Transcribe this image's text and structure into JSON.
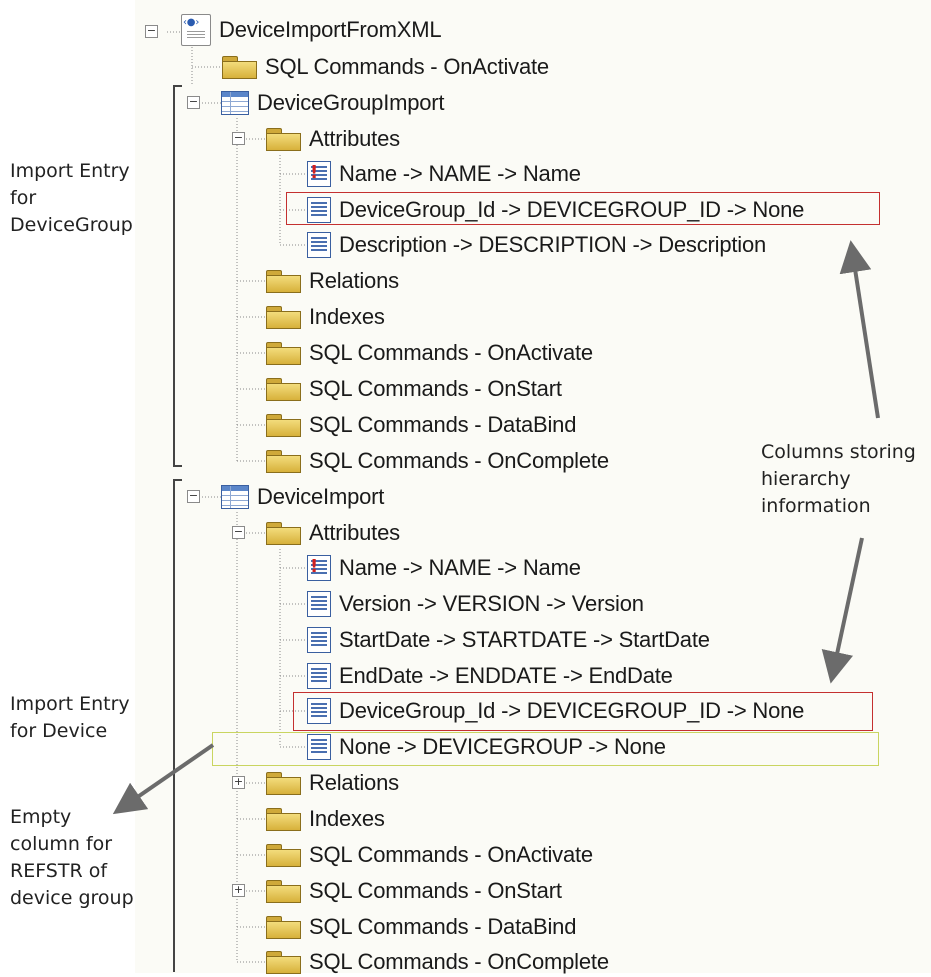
{
  "tree": {
    "root": "DeviceImportFromXML",
    "root_sql_onactivate": "SQL Commands - OnActivate",
    "group": {
      "label": "DeviceGroupImport",
      "attributes": "Attributes",
      "attr_name": "Name -> NAME -> Name",
      "attr_devicegroup_id": "DeviceGroup_Id -> DEVICEGROUP_ID -> None",
      "attr_description": "Description -> DESCRIPTION -> Description",
      "relations": "Relations",
      "indexes": "Indexes",
      "sql_onactivate": "SQL Commands - OnActivate",
      "sql_onstart": "SQL Commands - OnStart",
      "sql_databind": "SQL Commands - DataBind",
      "sql_oncomplete": "SQL Commands - OnComplete"
    },
    "device": {
      "label": "DeviceImport",
      "attributes": "Attributes",
      "attr_name": "Name -> NAME -> Name",
      "attr_version": "Version -> VERSION -> Version",
      "attr_startdate": "StartDate -> STARTDATE -> StartDate",
      "attr_enddate": "EndDate -> ENDDATE -> EndDate",
      "attr_devicegroup_id": "DeviceGroup_Id -> DEVICEGROUP_ID -> None",
      "attr_none": "None -> DEVICEGROUP -> None",
      "relations": "Relations",
      "indexes": "Indexes",
      "sql_onactivate": "SQL Commands - OnActivate",
      "sql_onstart": "SQL Commands - OnStart",
      "sql_databind": "SQL Commands - DataBind",
      "sql_oncomplete": "SQL Commands - OnComplete"
    }
  },
  "annotations": {
    "group_entry": [
      "Import Entry",
      "for",
      "DeviceGroup"
    ],
    "columns_hierarchy": [
      "Columns storing",
      "hierarchy",
      "information"
    ],
    "device_entry": [
      "Import Entry",
      "for Device"
    ],
    "empty_column": [
      "Empty",
      "column for",
      "REFSTR of",
      "device group"
    ]
  },
  "colors": {
    "tree_background": "#fbfbf6",
    "highlight_red": "#c43030",
    "highlight_yellow": "#c9d560",
    "arrow": "#6b6b6b"
  }
}
